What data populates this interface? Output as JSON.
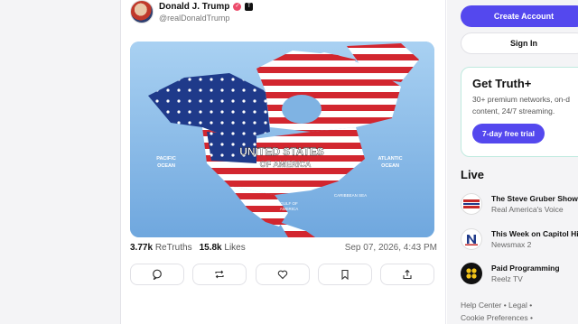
{
  "post": {
    "author_name": "Donald J. Trump",
    "handle": "@realDonaldTrump",
    "image_labels": {
      "main_line1": "UNITED STATES",
      "main_line2": "OF AMERICA",
      "pacific_line1": "PACIFIC",
      "pacific_line2": "OCEAN",
      "atlantic_line1": "ATLANTIC",
      "atlantic_line2": "OCEAN",
      "gulf_line1": "GULF OF",
      "gulf_line2": "AMERICA",
      "caribbean": "CARIBBEAN SEA"
    },
    "retruths_count": "3.77k",
    "retruths_label": "ReTruths",
    "likes_count": "15.8k",
    "likes_label": "Likes",
    "date": "Sep 07, 2026, 4:43 PM",
    "actions": [
      {
        "icon": "reply-icon"
      },
      {
        "icon": "retruth-icon"
      },
      {
        "icon": "heart-icon"
      },
      {
        "icon": "bookmark-icon"
      },
      {
        "icon": "share-icon"
      }
    ]
  },
  "sidebar": {
    "create_account": "Create Account",
    "sign_in": "Sign In",
    "truth_plus": {
      "title": "Get Truth+",
      "desc_line1": "30+ premium networks, on-d",
      "desc_line2": "content, 24/7 streaming.",
      "trial_label": "7-day free trial"
    },
    "live_title": "Live",
    "live": [
      {
        "show": "The Steve Gruber Show",
        "network": "Real America's Voice",
        "logo": "rav-logo"
      },
      {
        "show": "This Week on Capitol Hi",
        "network": "Newsmax 2",
        "logo": "newsmax-logo"
      },
      {
        "show": "Paid Programming",
        "network": "Reelz TV",
        "logo": "reelz-logo"
      }
    ],
    "footer": {
      "line1": "Help Center • Legal •",
      "line2": "Cookie Preferences •"
    }
  },
  "colors": {
    "accent": "#5448ee",
    "verified": "#ec4c6b"
  }
}
